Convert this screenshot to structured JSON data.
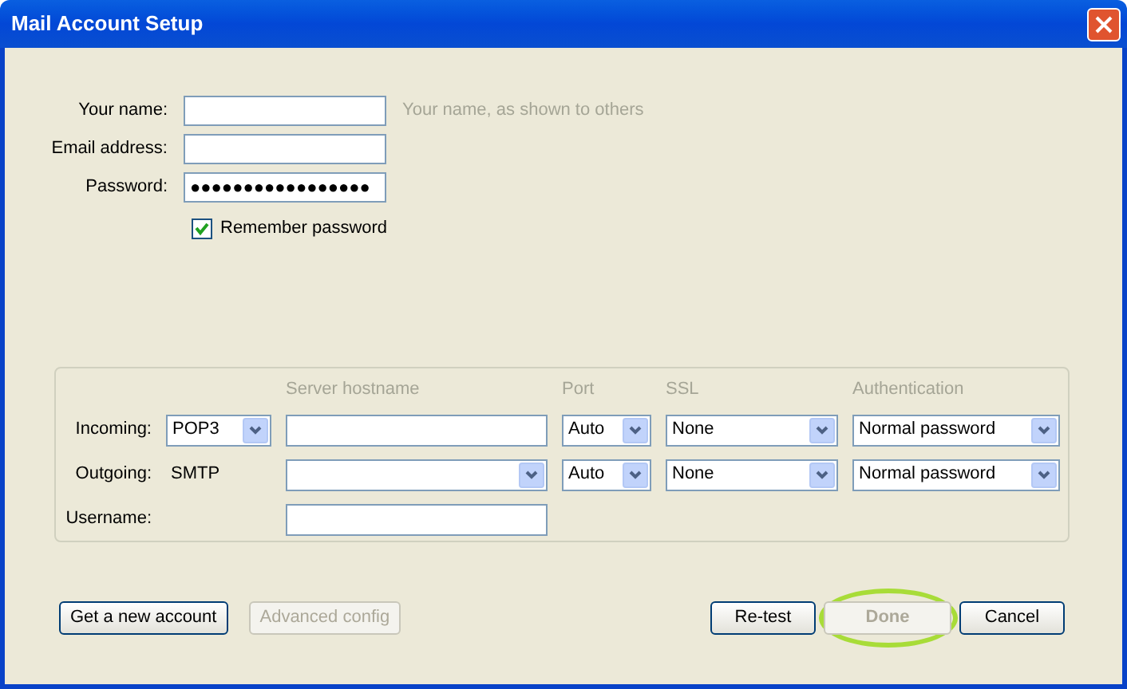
{
  "window": {
    "title": "Mail Account Setup"
  },
  "fields": [
    {
      "label": "Your name:",
      "hint": "Your name, as shown to others"
    },
    {
      "label": "Email address:"
    },
    {
      "label": "Password:",
      "value": "●●●●●●●●●●●●●●●●●"
    }
  ],
  "remember_password": {
    "label": "Remember password",
    "checked": true
  },
  "server": {
    "columns": [
      "Server hostname",
      "Port",
      "SSL",
      "Authentication"
    ],
    "rows": [
      {
        "label": "Incoming:",
        "protocol": {
          "kind": "select",
          "text": "POP3"
        },
        "hostname": {
          "kind": "text"
        },
        "port": "Auto",
        "ssl": "None",
        "authentication": "Normal password"
      },
      {
        "label": "Outgoing:",
        "protocol": {
          "kind": "static",
          "text": "SMTP"
        },
        "hostname": {
          "kind": "select"
        },
        "port": "Auto",
        "ssl": "None",
        "authentication": "Normal password"
      }
    ],
    "username": {
      "label": "Username:"
    }
  },
  "buttons_left": [
    {
      "label": "Get a new account",
      "disabled": false,
      "highlighted": false
    },
    {
      "label": "Advanced config",
      "disabled": true,
      "highlighted": false
    }
  ],
  "buttons_right": [
    {
      "label": "Re-test",
      "disabled": false,
      "highlighted": false
    },
    {
      "label": "Done",
      "disabled": true,
      "highlighted": true
    },
    {
      "label": "Cancel",
      "disabled": false,
      "highlighted": false
    }
  ]
}
